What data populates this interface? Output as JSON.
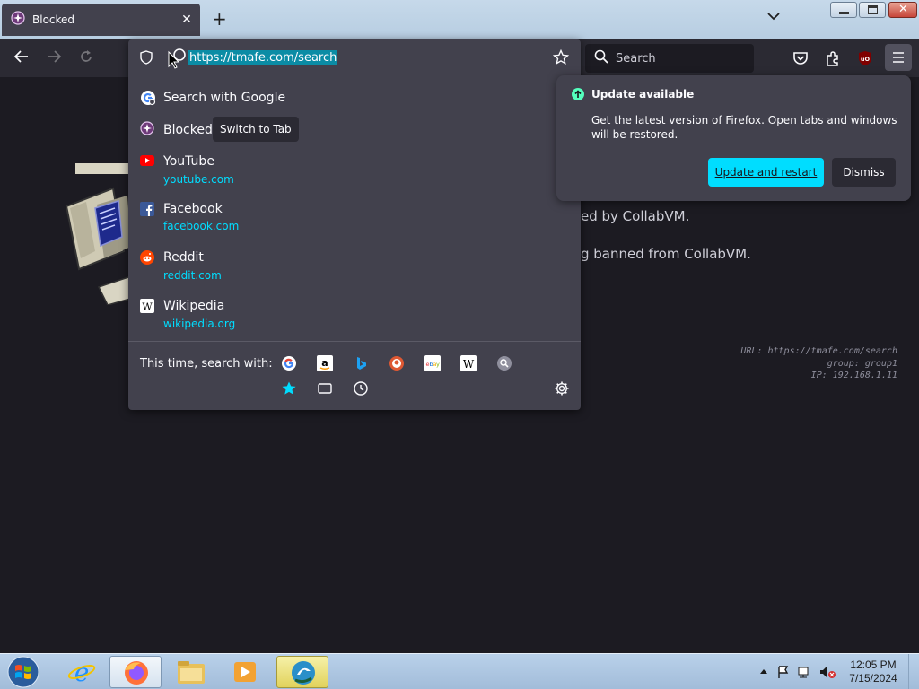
{
  "tab": {
    "title": "Blocked"
  },
  "urlbar": {
    "url": "https://tmafe.com/search"
  },
  "search_bar": {
    "placeholder": "Search"
  },
  "suggestions": [
    {
      "title": "Search with Google",
      "url": "",
      "icon": "google-icon"
    },
    {
      "title": "Blocked",
      "url": "",
      "icon": "blocked-favicon",
      "badge": "Switch to Tab"
    },
    {
      "title": "YouTube",
      "url": "youtube.com",
      "icon": "youtube-icon"
    },
    {
      "title": "Facebook",
      "url": "facebook.com",
      "icon": "facebook-icon"
    },
    {
      "title": "Reddit",
      "url": "reddit.com",
      "icon": "reddit-icon"
    },
    {
      "title": "Wikipedia",
      "url": "wikipedia.org",
      "icon": "wikipedia-icon"
    }
  ],
  "one_off": {
    "label": "This time, search with:",
    "engines": [
      "google-icon",
      "amazon-icon",
      "bing-icon",
      "duckduckgo-icon",
      "ebay-icon",
      "wikipedia-icon",
      "search-engine-icon",
      "bookmarks-icon",
      "tabs-icon",
      "history-icon",
      "settings-icon"
    ]
  },
  "update_panel": {
    "title": "Update available",
    "body": "Get the latest version of Firefox. Open tabs and windows will be restored.",
    "restart_label": "Update and restart",
    "dismiss_label": "Dismiss"
  },
  "page": {
    "line1": "ed by CollabVM.",
    "line2": "g banned from CollabVM.",
    "meta_url": "URL: https://tmafe.com/search",
    "meta_group": "group: group1",
    "meta_ip": "IP: 192.168.1.11"
  },
  "clock": {
    "time": "12:05 PM",
    "date": "7/15/2024"
  },
  "colors": {
    "accent": "#00ddff",
    "panel": "#42414d",
    "toolbar": "#2b2a33",
    "background": "#1c1b22"
  }
}
